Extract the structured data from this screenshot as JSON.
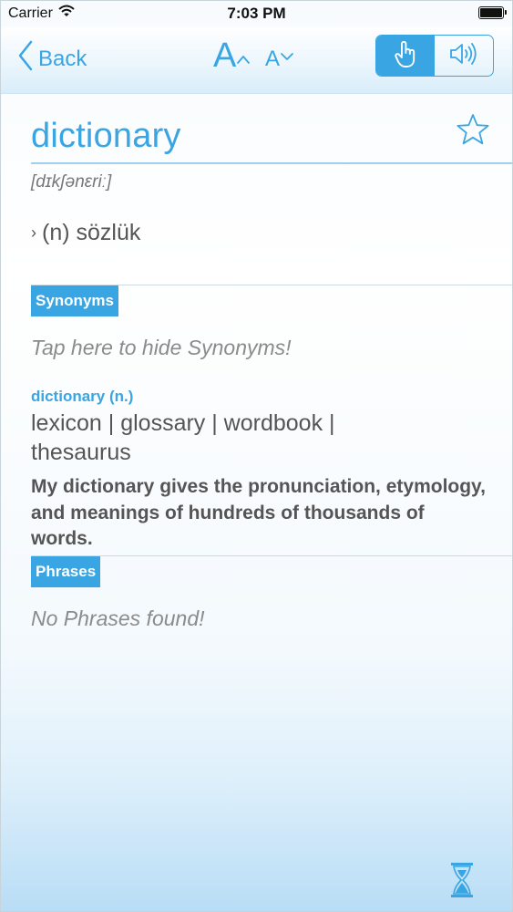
{
  "status_bar": {
    "carrier": "Carrier",
    "time": "7:03 PM"
  },
  "nav": {
    "back_label": "Back",
    "font_increase": "A",
    "font_decrease": "A"
  },
  "entry": {
    "word": "dictionary",
    "phonetic": "[dɪkʃənɛriː]",
    "meaning": "(n) sözlük"
  },
  "synonyms": {
    "header": "Synonyms",
    "hint": "Tap here to hide Synonyms!",
    "title": "dictionary (n.)",
    "words": "lexicon | glossary | wordbook | thesaurus",
    "example": "My dictionary gives the pronunciation, etymology, and meanings of hundreds of thousands of words."
  },
  "phrases": {
    "header": "Phrases",
    "hint": "No Phrases found!"
  },
  "colors": {
    "accent": "#3aa5e3"
  },
  "icons": {
    "back": "chevron-left-icon",
    "favorite": "star-outline-icon",
    "touch": "hand-pointer-icon",
    "sound": "speaker-icon",
    "history": "hourglass-icon"
  }
}
